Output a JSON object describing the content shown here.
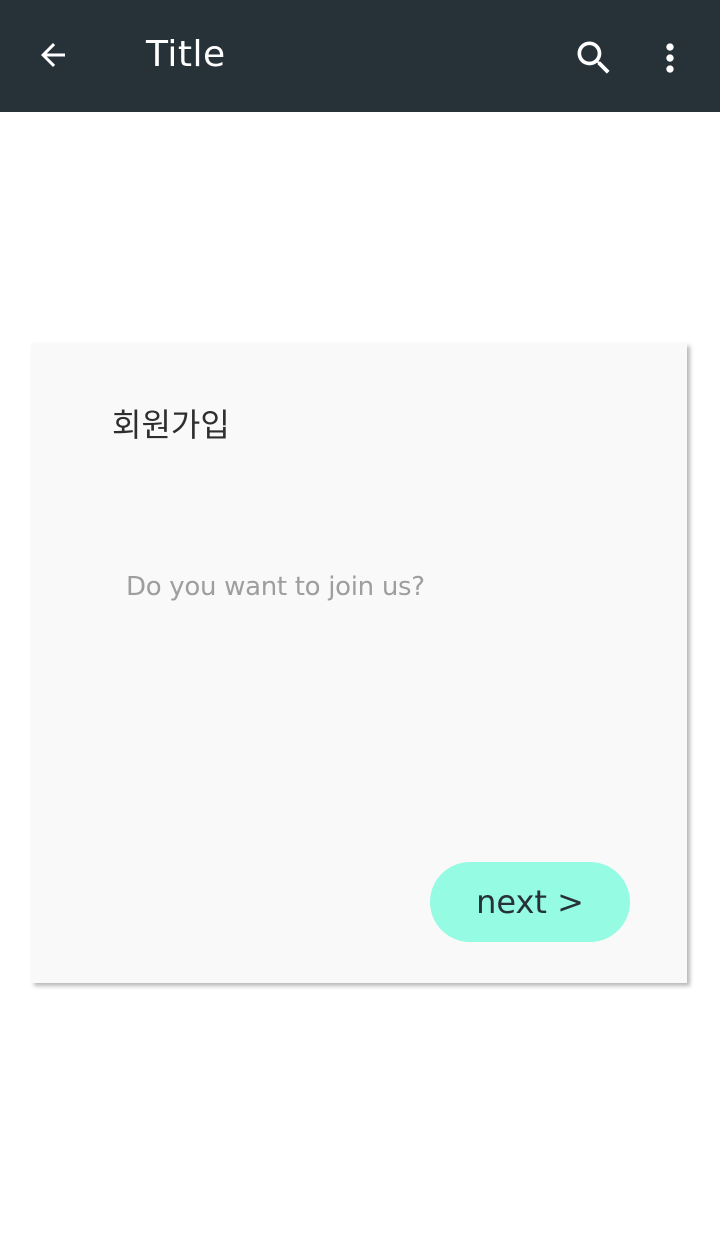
{
  "app_bar": {
    "title": "Title",
    "back_icon": "arrow-back-icon",
    "search_icon": "search-icon",
    "more_icon": "more-vert-icon",
    "background_color": "#263238"
  },
  "card": {
    "title": "회원가입",
    "message": "Do you want to join us?",
    "next_label": "next >",
    "button_color": "#95fbe3"
  }
}
